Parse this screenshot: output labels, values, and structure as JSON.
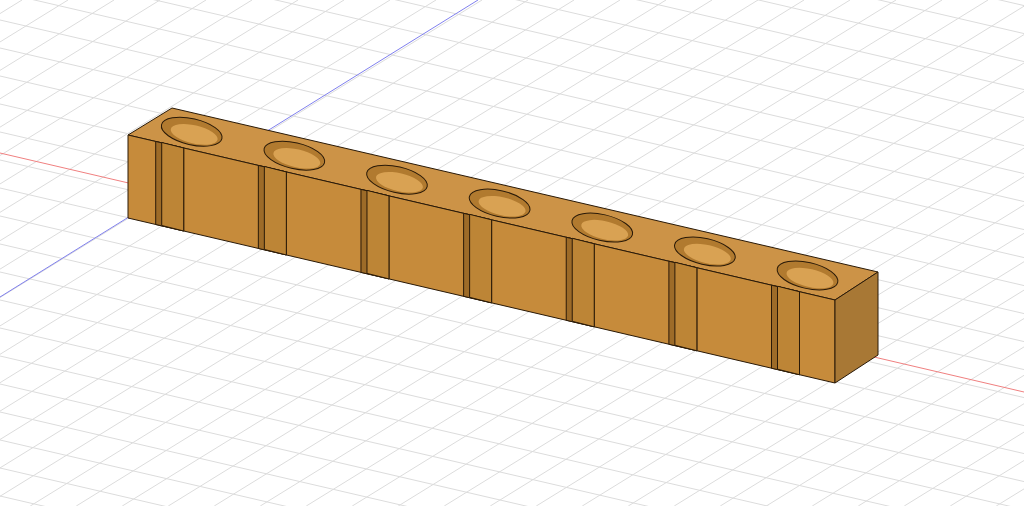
{
  "viewport": {
    "model": {
      "slots": [
        {
          "kind": "keyhole"
        },
        {
          "kind": "keyhole"
        },
        {
          "kind": "keyhole"
        },
        {
          "kind": "keyhole"
        },
        {
          "kind": "keyhole"
        },
        {
          "kind": "keyhole"
        },
        {
          "kind": "keyhole"
        }
      ]
    }
  }
}
